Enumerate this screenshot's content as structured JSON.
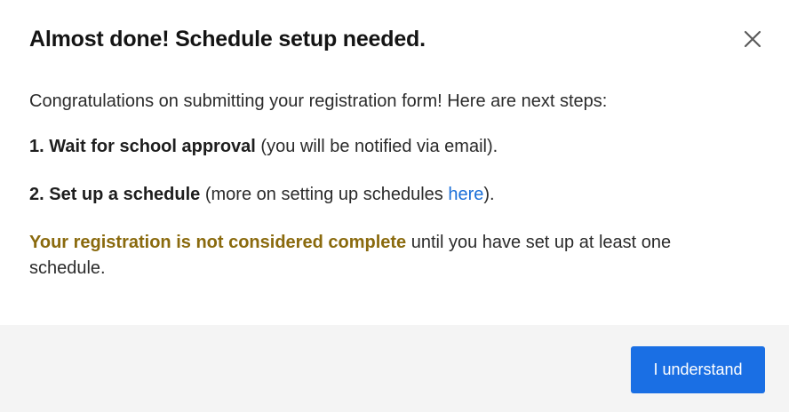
{
  "dialog": {
    "title": "Almost done! Schedule setup needed.",
    "close_icon": "close-icon",
    "intro": "Congratulations on submitting your registration form! Here are next steps:",
    "step1": {
      "bold": "1. Wait for school approval",
      "rest": " (you will be notified via email)."
    },
    "step2": {
      "bold": "2. Set up a schedule",
      "rest_before": " (more on setting up schedules ",
      "link": "here",
      "rest_after": ")."
    },
    "warning": {
      "bold": "Your registration is not considered complete",
      "rest": " until you have set up at least one schedule."
    }
  },
  "footer": {
    "button_label": "I understand"
  },
  "colors": {
    "accent": "#1a6fe4",
    "link": "#1a6fd8",
    "warning": "#8a6a0e",
    "footer_bg": "#f4f4f4"
  }
}
